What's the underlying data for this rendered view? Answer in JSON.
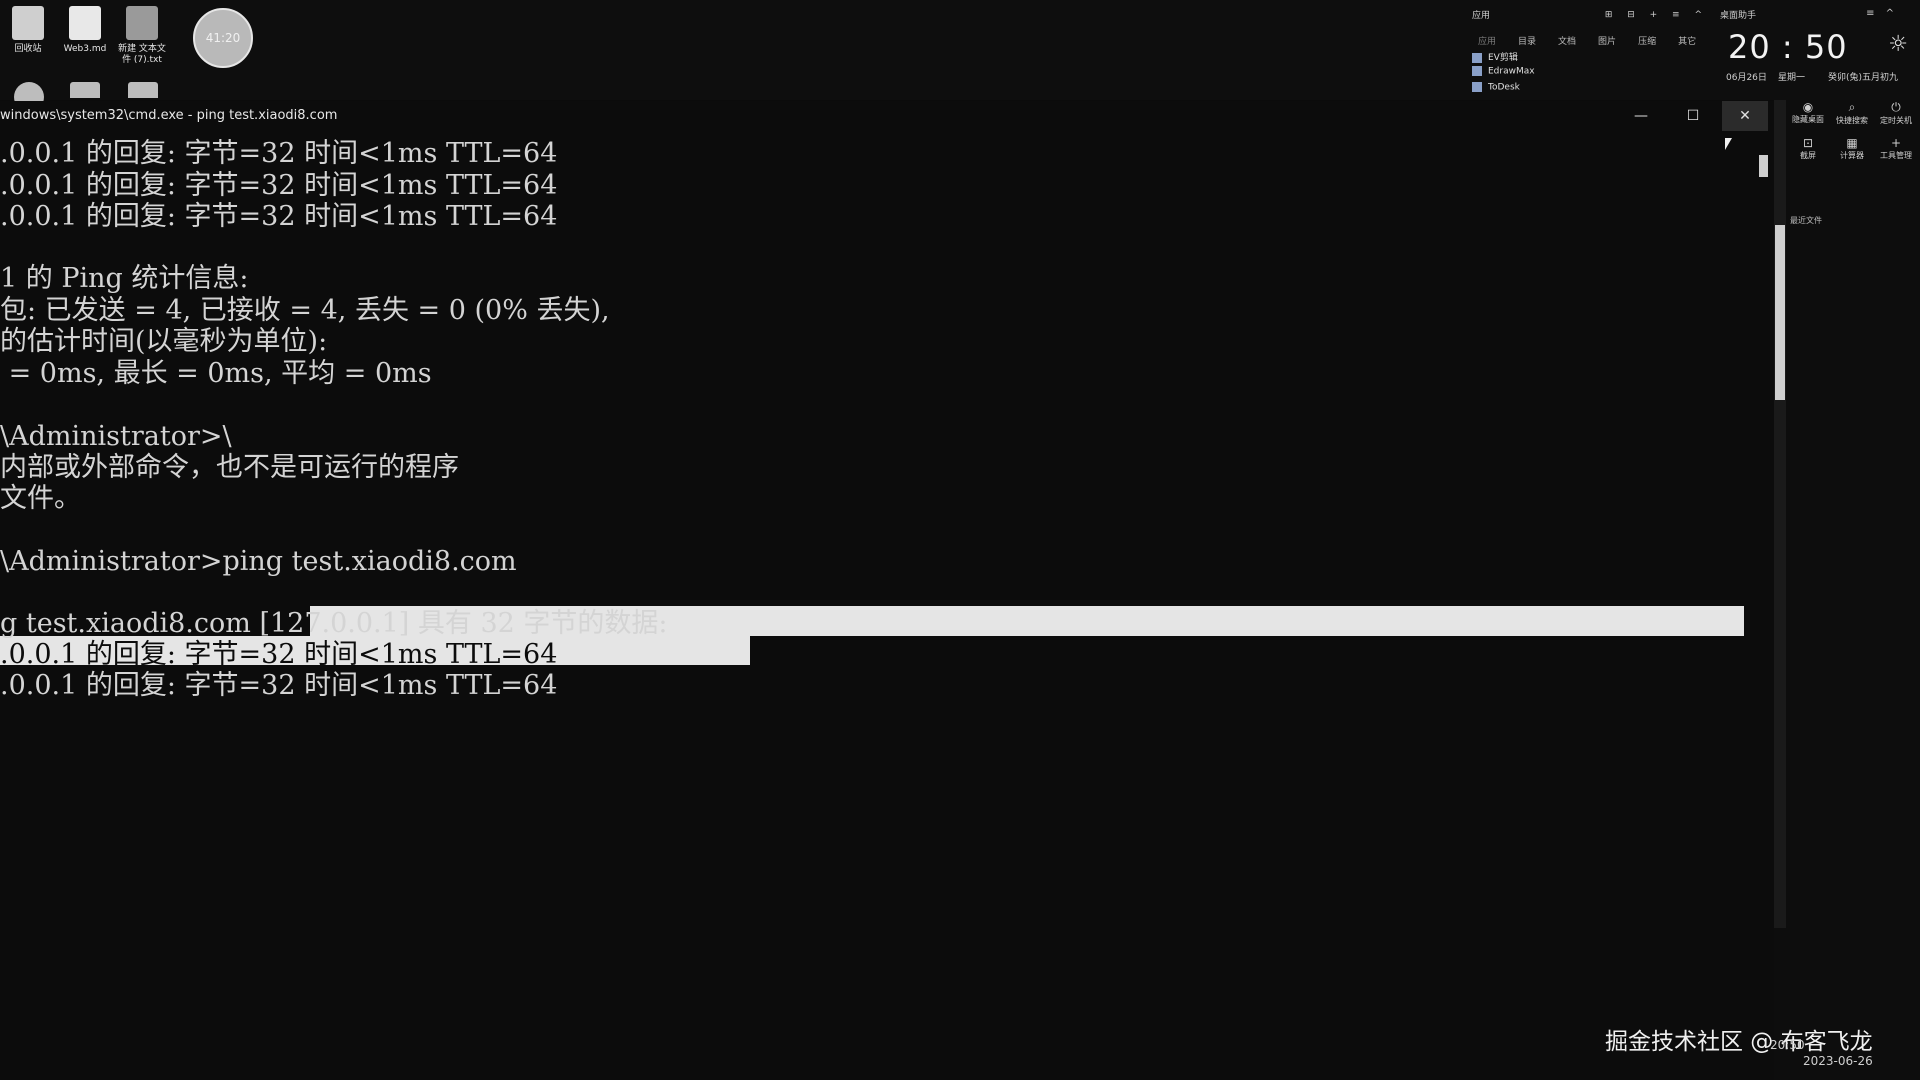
{
  "desktop": {
    "icons": [
      {
        "label": "回收站"
      },
      {
        "label": "Web3.md"
      },
      {
        "label": "新建 文本文件 (7).txt"
      }
    ],
    "timer": "41:20"
  },
  "widget": {
    "header": "应用",
    "tabs": [
      "应用",
      "目录",
      "文档",
      "图片",
      "压缩",
      "其它"
    ],
    "controls": "⊞ ⊟ + ≡ ^",
    "apps": [
      "EV剪辑",
      "EdrawMax",
      "ToDesk"
    ]
  },
  "clock": {
    "helper_title": "桌面助手",
    "menu": "≡ ^",
    "time": "20 : 50",
    "date": "06月26日",
    "weekday": "星期一",
    "lunar": "癸卯(兔)五月初九"
  },
  "side_tools": [
    {
      "icon": "eye-icon",
      "label": "隐藏桌面"
    },
    {
      "icon": "search-icon",
      "label": "快捷搜索"
    },
    {
      "icon": "power-icon",
      "label": "定时关机"
    },
    {
      "icon": "screenshot-icon",
      "label": "截屏"
    },
    {
      "icon": "calculator-icon",
      "label": "计算器"
    },
    {
      "icon": "plus-icon",
      "label": "工具管理"
    }
  ],
  "side_panel": {
    "label": "最近文件"
  },
  "cmd": {
    "title": "windows\\system32\\cmd.exe - ping  test.xiaodi8.com",
    "buttons": {
      "minimize": "—",
      "maximize": "☐",
      "close": "✕"
    },
    "lines": [
      ".0.0.1 的回复: 字节=32 时间<1ms TTL=64",
      ".0.0.1 的回复: 字节=32 时间<1ms TTL=64",
      ".0.0.1 的回复: 字节=32 时间<1ms TTL=64",
      "",
      "1 的 Ping 统计信息:",
      "包: 已发送 = 4, 已接收 = 4, 丢失 = 0 (0% 丢失),",
      "的估计时间(以毫秒为单位):",
      " = 0ms, 最长 = 0ms, 平均 = 0ms",
      "",
      "\\Administrator>\\",
      "内部或外部命令，也不是可运行的程序",
      "文件。",
      "",
      "\\Administrator>ping test.xiaodi8.com",
      "",
      "g test.xiaodi8.com [127.0.0.1] 具有 32 字节的数据:",
      ".0.0.1 的回复: 字节=32 时间<1ms TTL=64",
      ".0.0.1 的回复: 字节=32 时间<1ms TTL=64"
    ]
  },
  "watermark": "掘金技术社区 @ 布客飞龙",
  "tray": {
    "time": "20:50",
    "date": "2023-06-26"
  }
}
